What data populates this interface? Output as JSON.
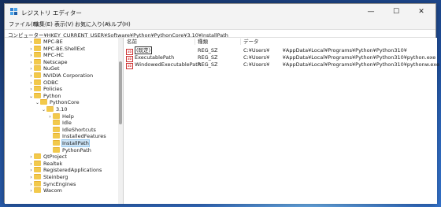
{
  "window": {
    "title": "レジストリ エディター"
  },
  "menu": [
    "ファイル(F)",
    "編集(E)",
    "表示(V)",
    "お気に入り(A)",
    "ヘルプ(H)"
  ],
  "address": "コンピューター¥HKEY_CURRENT_USER¥Software¥Python¥PythonCore¥3.10¥InstallPath",
  "tree": [
    {
      "label": "MPC-BE",
      "level": 0,
      "chevron": ">"
    },
    {
      "label": "MPC-BE.ShellExt",
      "level": 0,
      "chevron": ">"
    },
    {
      "label": "MPC-HC",
      "level": 0,
      "chevron": ">"
    },
    {
      "label": "Netscape",
      "level": 0,
      "chevron": ">"
    },
    {
      "label": "NuGet",
      "level": 0,
      "chevron": ">"
    },
    {
      "label": "NVIDIA Corporation",
      "level": 0,
      "chevron": ">"
    },
    {
      "label": "ODBC",
      "level": 0,
      "chevron": ">"
    },
    {
      "label": "Policies",
      "level": 0,
      "chevron": ">"
    },
    {
      "label": "Python",
      "level": 0,
      "chevron": "v"
    },
    {
      "label": "PythonCore",
      "level": 1,
      "chevron": "v"
    },
    {
      "label": "3.10",
      "level": 2,
      "chevron": "v"
    },
    {
      "label": "Help",
      "level": 3,
      "chevron": ">"
    },
    {
      "label": "Idle",
      "level": 3,
      "chevron": ""
    },
    {
      "label": "IdleShortcuts",
      "level": 3,
      "chevron": ""
    },
    {
      "label": "InstalledFeatures",
      "level": 3,
      "chevron": ""
    },
    {
      "label": "InstallPath",
      "level": 3,
      "chevron": "",
      "selected": true
    },
    {
      "label": "PythonPath",
      "level": 3,
      "chevron": ""
    },
    {
      "label": "QtProject",
      "level": 0,
      "chevron": ">"
    },
    {
      "label": "Realtek",
      "level": 0,
      "chevron": ">"
    },
    {
      "label": "RegisteredApplications",
      "level": 0,
      "chevron": ">"
    },
    {
      "label": "Steinberg",
      "level": 0,
      "chevron": ">"
    },
    {
      "label": "SyncEngines",
      "level": 0,
      "chevron": ">"
    },
    {
      "label": "Wacom",
      "level": 0,
      "chevron": ">"
    }
  ],
  "columns": {
    "name": "名前",
    "type": "種類",
    "data": "データ"
  },
  "values": [
    {
      "name": "(既定)",
      "type": "REG_SZ",
      "data": "C:¥Users¥        ¥AppData¥Local¥Programs¥Python¥Python310¥",
      "is_default": true
    },
    {
      "name": "ExecutablePath",
      "type": "REG_SZ",
      "data": "C:¥Users¥        ¥AppData¥Local¥Programs¥Python¥Python310¥python.exe"
    },
    {
      "name": "WindowedExecutablePath",
      "type": "REG_SZ",
      "data": "C:¥Users¥        ¥AppData¥Local¥Programs¥Python¥Python310¥pythonw.exe"
    }
  ],
  "icons": {
    "minimize": "minimize-icon",
    "maximize": "maximize-icon",
    "close": "close-icon",
    "folder": "folder-icon",
    "string_value": "reg-sz-icon"
  }
}
